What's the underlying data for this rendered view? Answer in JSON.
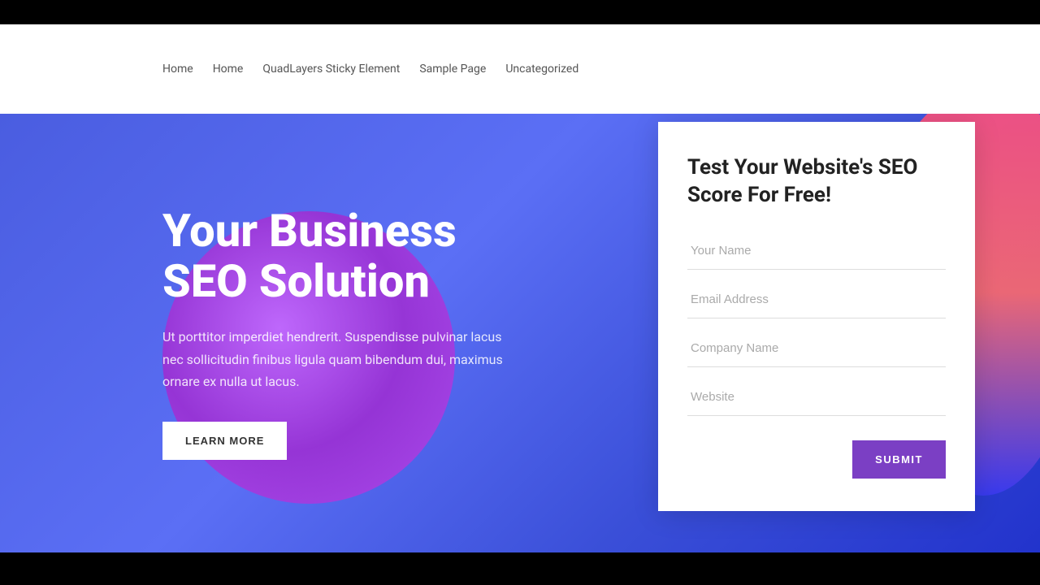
{
  "topbar": {},
  "nav": {
    "items": [
      {
        "label": "Home",
        "id": "home1"
      },
      {
        "label": "Home",
        "id": "home2"
      },
      {
        "label": "QuadLayers Sticky Element",
        "id": "quadlayers"
      },
      {
        "label": "Sample Page",
        "id": "sample"
      },
      {
        "label": "Uncategorized",
        "id": "uncategorized"
      }
    ]
  },
  "hero": {
    "title": "Your Business SEO Solution",
    "description": "Ut porttitor imperdiet hendrerit. Suspendisse pulvinar lacus nec sollicitudin finibus ligula quam bibendum dui, maximus ornare ex nulla ut lacus.",
    "cta_label": "LEARN MORE"
  },
  "form": {
    "title": "Test Your Website's SEO Score For Free!",
    "fields": [
      {
        "placeholder": "Your Name",
        "type": "text",
        "name": "your-name"
      },
      {
        "placeholder": "Email Address",
        "type": "email",
        "name": "email-address"
      },
      {
        "placeholder": "Company Name",
        "type": "text",
        "name": "company-name"
      },
      {
        "placeholder": "Website",
        "type": "url",
        "name": "website"
      }
    ],
    "submit_label": "SUBMIT"
  }
}
